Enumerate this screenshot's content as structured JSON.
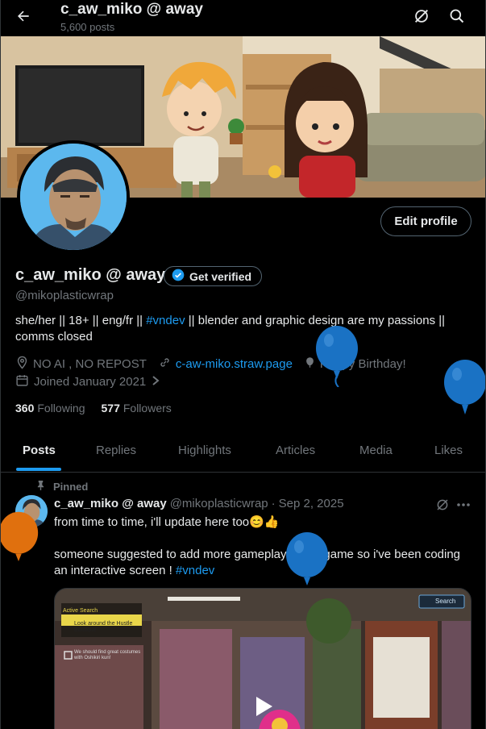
{
  "header": {
    "title": "c_aw_miko @ away",
    "posts_count": "5,600 posts"
  },
  "profile": {
    "display_name": "c_aw_miko @ away",
    "get_verified": "Get verified",
    "handle": "@mikoplasticwrap",
    "edit_profile": "Edit profile",
    "bio_part1": "she/her || 18+ || eng/fr || ",
    "bio_hashtag": "#vndev",
    "bio_part2": " || blender and graphic design are my passions || comms closed",
    "location": "NO AI , NO REPOST",
    "website": "c-aw-miko.straw.page",
    "birthday": "Happy Birthday!",
    "joined": "Joined January 2021",
    "following_count": "360",
    "following_label": "Following",
    "followers_count": "577",
    "followers_label": "Followers"
  },
  "tabs": [
    {
      "label": "Posts",
      "active": true
    },
    {
      "label": "Replies"
    },
    {
      "label": "Highlights"
    },
    {
      "label": "Articles"
    },
    {
      "label": "Media"
    },
    {
      "label": "Likes"
    }
  ],
  "pinned_post": {
    "pinned_label": "Pinned",
    "author_name": "c_aw_miko @ away",
    "author_handle": "@mikoplasticwrap",
    "separator": "·",
    "date": "Sep 2, 2025",
    "line1": "from time to time, i'll update here too😊👍",
    "line2": "someone suggested to add more gameplay to the game so i've been coding an interactive screen ! ",
    "hashtag": "#vndev",
    "media": {
      "active_search": "Active Search",
      "task1": "Look around the Hustle Boutique",
      "task2": "We should find great costumes with Oshikiri kun!",
      "search": "Search"
    }
  },
  "colors": {
    "accent": "#1d9bf0",
    "muted": "#71767b",
    "border": "#2f3336",
    "balloon_blue": "#1a72c4",
    "balloon_orange": "#e0700e"
  }
}
